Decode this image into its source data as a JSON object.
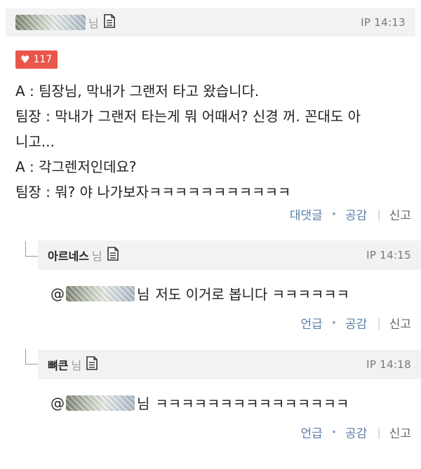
{
  "post": {
    "author_suffix": "님",
    "ip_time": "IP 14:13",
    "like_count": "117",
    "lines": [
      "A : 팀장님, 막내가 그랜저 타고 왔습니다.",
      "팀장 : 막내가 그랜저 타는게 뭐 어때서? 신경 꺼. 꼰대도 아",
      "니고...",
      "A : 각그렌저인데요?",
      "팀장 : 뭐? 야 나가보자ㅋㅋㅋㅋㅋㅋㅋㅋㅋㅋㅋ"
    ],
    "actions": {
      "reply": "대댓글",
      "like": "공감",
      "report": "신고"
    }
  },
  "replies": [
    {
      "author": "아르네스",
      "author_suffix": "님",
      "ip_time": "IP 14:15",
      "at": "@",
      "mention_suffix": "님",
      "text": "저도 이거로 봅니다 ㅋㅋㅋㅋㅋㅋ",
      "actions": {
        "mention": "언급",
        "like": "공감",
        "report": "신고"
      }
    },
    {
      "author": "뼈큰",
      "author_suffix": "님",
      "ip_time": "IP 14:18",
      "at": "@",
      "mention_suffix": "님",
      "text": "ㅋㅋㅋㅋㅋㅋㅋㅋㅋㅋㅋㅋㅋㅋㅋ",
      "actions": {
        "mention": "언급",
        "like": "공감",
        "report": "신고"
      }
    }
  ],
  "icons": {
    "like": "heart-icon",
    "document": "document-icon"
  },
  "colors": {
    "like_badge": "#e8574a",
    "action_link": "#5a7fa8",
    "header_bg": "#f2f2f2"
  }
}
